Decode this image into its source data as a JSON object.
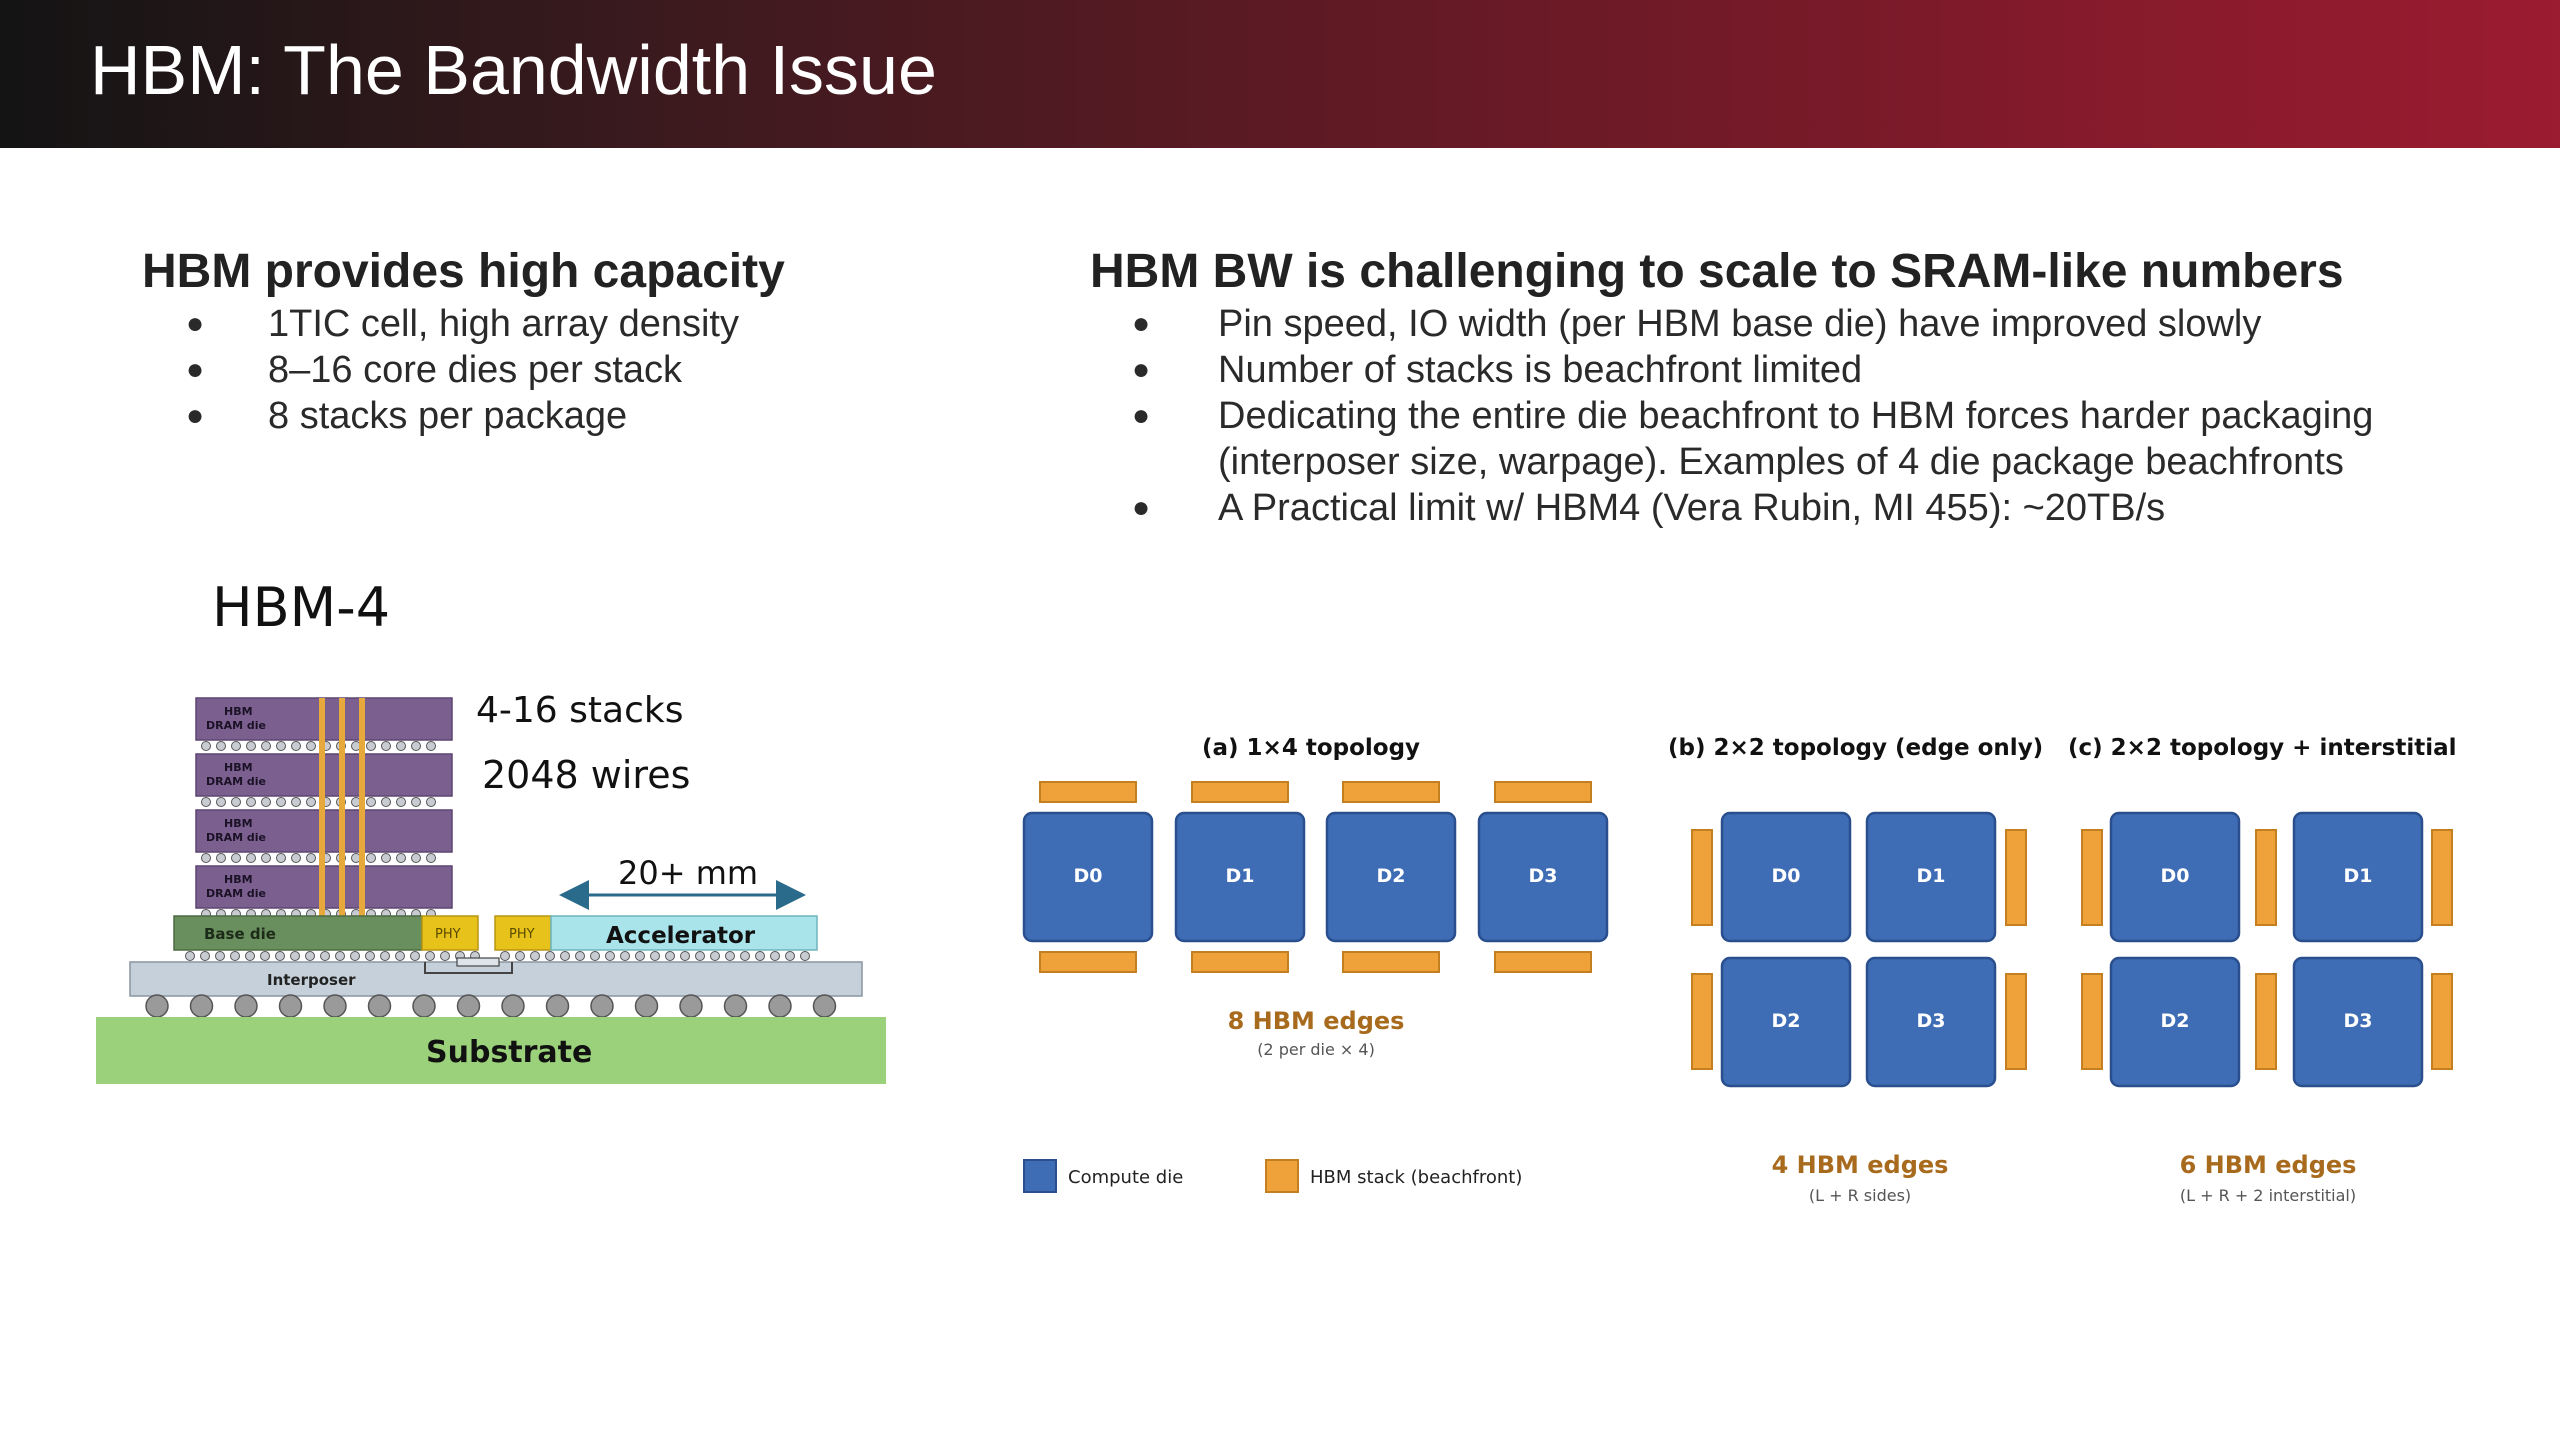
{
  "slide": {
    "title": "HBM: The Bandwidth Issue",
    "accent_color": "#9b1b30"
  },
  "left": {
    "heading": "HBM provides high capacity",
    "bullets": [
      "1TIC cell, high array density",
      "8–16 core dies per stack",
      "8 stacks per package"
    ]
  },
  "right": {
    "heading": "HBM BW is challenging to scale to SRAM-like numbers",
    "bullets": [
      "Pin speed, IO width (per HBM base die) have improved slowly",
      "Number of stacks is beachfront limited",
      "Dedicating the entire die beachfront to HBM forces harder packaging (interposer size, warpage). Examples of 4 die package beachfronts",
      "A Practical limit w/ HBM4 (Vera Rubin, MI 455): ~20TB/s"
    ],
    "bullet_glyph": "●"
  },
  "hbm_diagram": {
    "title": "HBM-4",
    "stacks_label": "4-16 stacks",
    "wires_label": "2048 wires",
    "distance_label": "20+ mm",
    "dram_die_label_line1": "HBM",
    "dram_die_label_line2": "DRAM die",
    "base_die_label": "Base die",
    "phy_label": "PHY",
    "accelerator_label": "Accelerator",
    "interposer_label": "Interposer",
    "substrate_label": "Substrate",
    "colors": {
      "dram_die": "#7a5f8f",
      "base_die": "#6a8f5e",
      "phy": "#e6c21a",
      "accelerator": "#a8e4ea",
      "interposer": "#c5d0da",
      "substrate": "#9ad17a",
      "tsv": "#e8a93c",
      "arrow": "#2a6a8a"
    }
  },
  "topology": {
    "panels": [
      {
        "title": "(a)  1×4 topology",
        "dies": [
          "D0",
          "D1",
          "D2",
          "D3"
        ],
        "edges_label": "8 HBM edges",
        "edges_note": "(2 per die × 4)"
      },
      {
        "title": "(b)  2×2 topology (edge only)",
        "dies": [
          "D0",
          "D1",
          "D2",
          "D3"
        ],
        "edges_label": "4 HBM edges",
        "edges_note": "(L + R sides)"
      },
      {
        "title": "(c)  2×2 topology + interstitial",
        "dies": [
          "D0",
          "D1",
          "D2",
          "D3"
        ],
        "edges_label": "6 HBM edges",
        "edges_note": "(L + R + 2 interstitial)"
      }
    ],
    "legend": {
      "compute": "Compute die",
      "hbm": "HBM stack (beachfront)"
    },
    "colors": {
      "compute_die": "#3f6db5",
      "compute_border": "#2a4f8e",
      "hbm_stack": "#f0a23a",
      "hbm_border": "#c47f20",
      "edges_text": "#a86a1c"
    }
  }
}
